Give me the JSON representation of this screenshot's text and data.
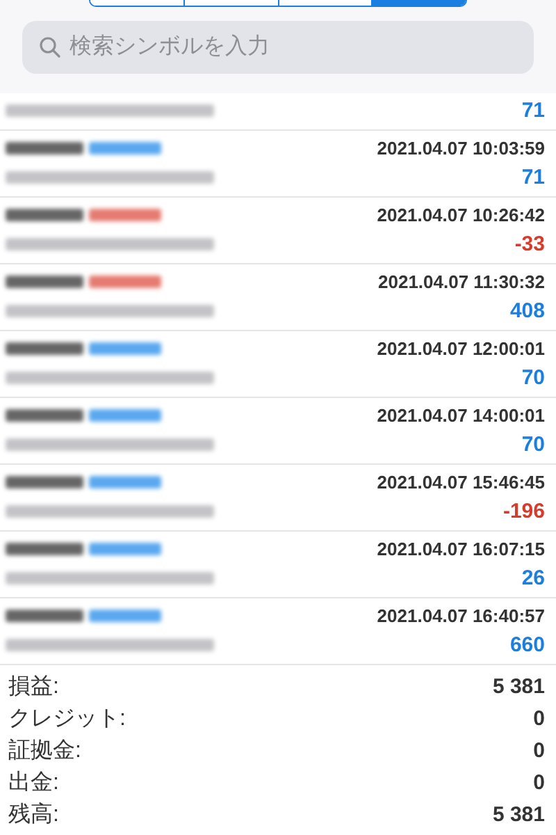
{
  "segments": [
    {
      "selected": false
    },
    {
      "selected": false
    },
    {
      "selected": false
    },
    {
      "selected": true
    }
  ],
  "search": {
    "placeholder": "検索シンボルを入力"
  },
  "deals": [
    {
      "profit": "71",
      "kind": "gain"
    },
    {
      "color": "#5aa8ef",
      "time": "2021.04.07 10:03:59",
      "profit": "71",
      "kind": "gain"
    },
    {
      "color": "#e57b70",
      "time": "2021.04.07 10:26:42",
      "profit": "-33",
      "kind": "loss"
    },
    {
      "color": "#e57b70",
      "time": "2021.04.07 11:30:32",
      "profit": "408",
      "kind": "gain"
    },
    {
      "color": "#5aa8ef",
      "time": "2021.04.07 12:00:01",
      "profit": "70",
      "kind": "gain"
    },
    {
      "color": "#5aa8ef",
      "time": "2021.04.07 14:00:01",
      "profit": "70",
      "kind": "gain"
    },
    {
      "color": "#5aa8ef",
      "time": "2021.04.07 15:46:45",
      "profit": "-196",
      "kind": "loss"
    },
    {
      "color": "#5aa8ef",
      "time": "2021.04.07 16:07:15",
      "profit": "26",
      "kind": "gain"
    },
    {
      "color": "#5aa8ef",
      "time": "2021.04.07 16:40:57",
      "profit": "660",
      "kind": "gain"
    }
  ],
  "summary": [
    {
      "label": "損益:",
      "value": "5 381"
    },
    {
      "label": "クレジット:",
      "value": "0"
    },
    {
      "label": "証拠金:",
      "value": "0"
    },
    {
      "label": "出金:",
      "value": "0"
    },
    {
      "label": "残高:",
      "value": "5 381"
    }
  ]
}
